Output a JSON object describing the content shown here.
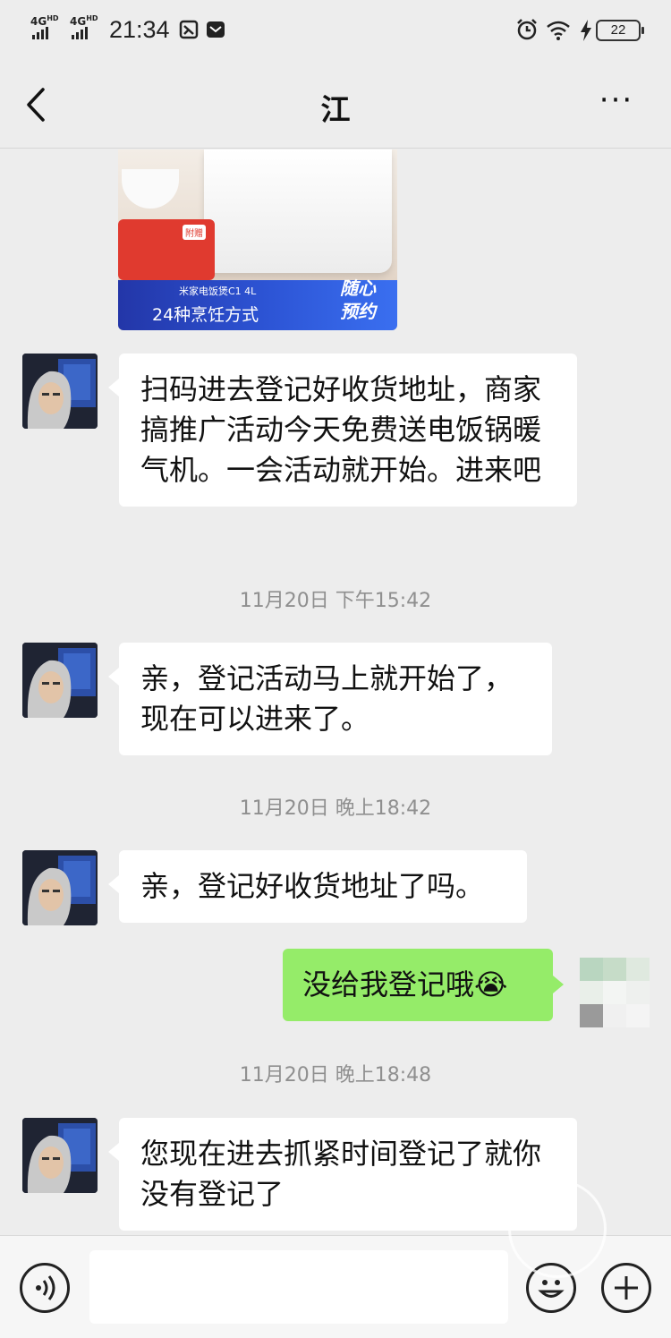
{
  "status_bar": {
    "network_1": "4G",
    "network_2": "4G",
    "network_suffix": "HD",
    "time": "21:34",
    "battery": "22",
    "icons": [
      "signal-icon",
      "signal-icon",
      "sim-icon",
      "message-icon",
      "alarm-icon",
      "wifi-icon",
      "charging-icon",
      "battery-icon"
    ]
  },
  "header": {
    "title": "江",
    "back_icon": "back-arrow-icon",
    "more_icon": "more-icon",
    "more_label": "···"
  },
  "product_card": {
    "gift_tag": "附赠",
    "model": "米家电饭煲C1 4L",
    "modes": "24种烹饪方式",
    "stamp_line1": "随心",
    "stamp_line2": "预约"
  },
  "messages": [
    {
      "side": "left",
      "text": "扫码进去登记好收货地址，商家搞推广活动今天免费送电饭锅暖气机。一会活动就开始。进来吧"
    },
    {
      "side": "left",
      "text": "亲，登记活动马上就开始了，现在可以进来了。"
    },
    {
      "side": "left",
      "text": "亲，登记好收货地址了吗。"
    },
    {
      "side": "right",
      "text": "没给我登记哦😭"
    },
    {
      "side": "left",
      "text": "您现在进去抓紧时间登记了就你没有登记了"
    }
  ],
  "timestamps": [
    "11月20日 下午15:42",
    "11月20日 晚上18:42",
    "11月20日 晚上18:48"
  ],
  "input_bar": {
    "voice_icon": "voice-icon",
    "emoji_icon": "emoji-icon",
    "plus_icon": "plus-icon",
    "input_value": ""
  },
  "colors": {
    "background": "#ededed",
    "bubble_incoming": "#ffffff",
    "bubble_outgoing": "#95ec69",
    "timestamp": "#8f8f8f"
  }
}
